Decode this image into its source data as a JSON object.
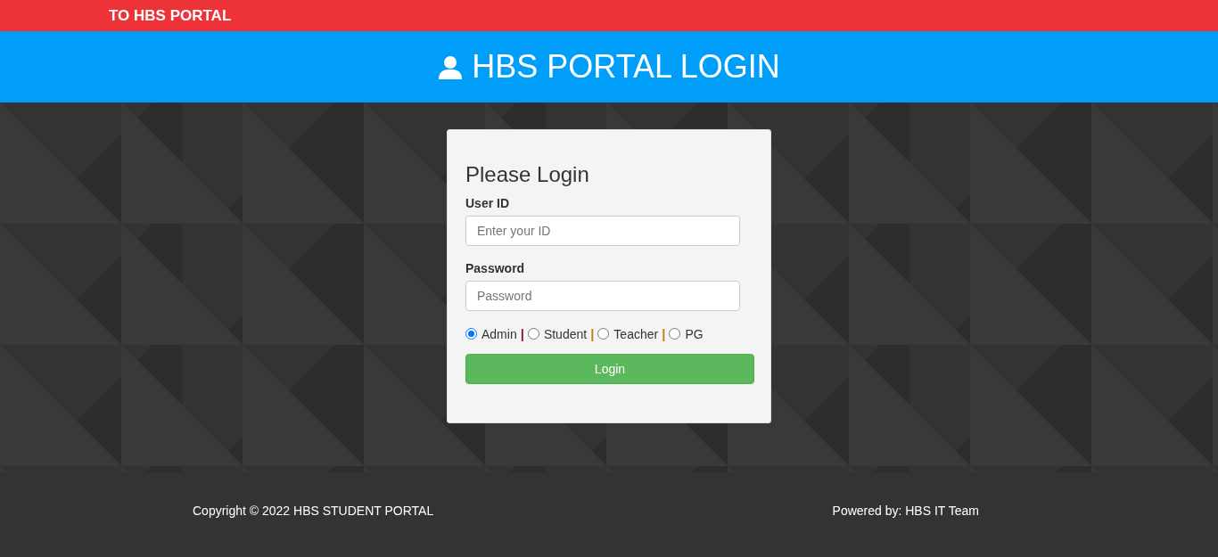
{
  "ticker": {
    "text": "TO HBS PORTAL"
  },
  "header": {
    "title": "HBS PORTAL LOGIN"
  },
  "login_form": {
    "heading": "Please Login",
    "fields": [
      {
        "label": "User ID",
        "placeholder": "Enter your ID"
      },
      {
        "label": "Password",
        "placeholder": "Password"
      }
    ],
    "roles": [
      {
        "label": "Admin",
        "selected": true,
        "separator": "|",
        "color": "#8b1a4a"
      },
      {
        "label": "Student",
        "selected": false,
        "separator": "|",
        "color": "#c87f0a"
      },
      {
        "label": "Teacher",
        "selected": false,
        "separator": "|",
        "color": "#c87f0a"
      },
      {
        "label": "PG",
        "selected": false
      }
    ],
    "submit": "Login"
  },
  "footer": {
    "copyright": "Copyright © 2022 HBS STUDENT PORTAL",
    "credit": "Powered by: HBS IT Team"
  }
}
